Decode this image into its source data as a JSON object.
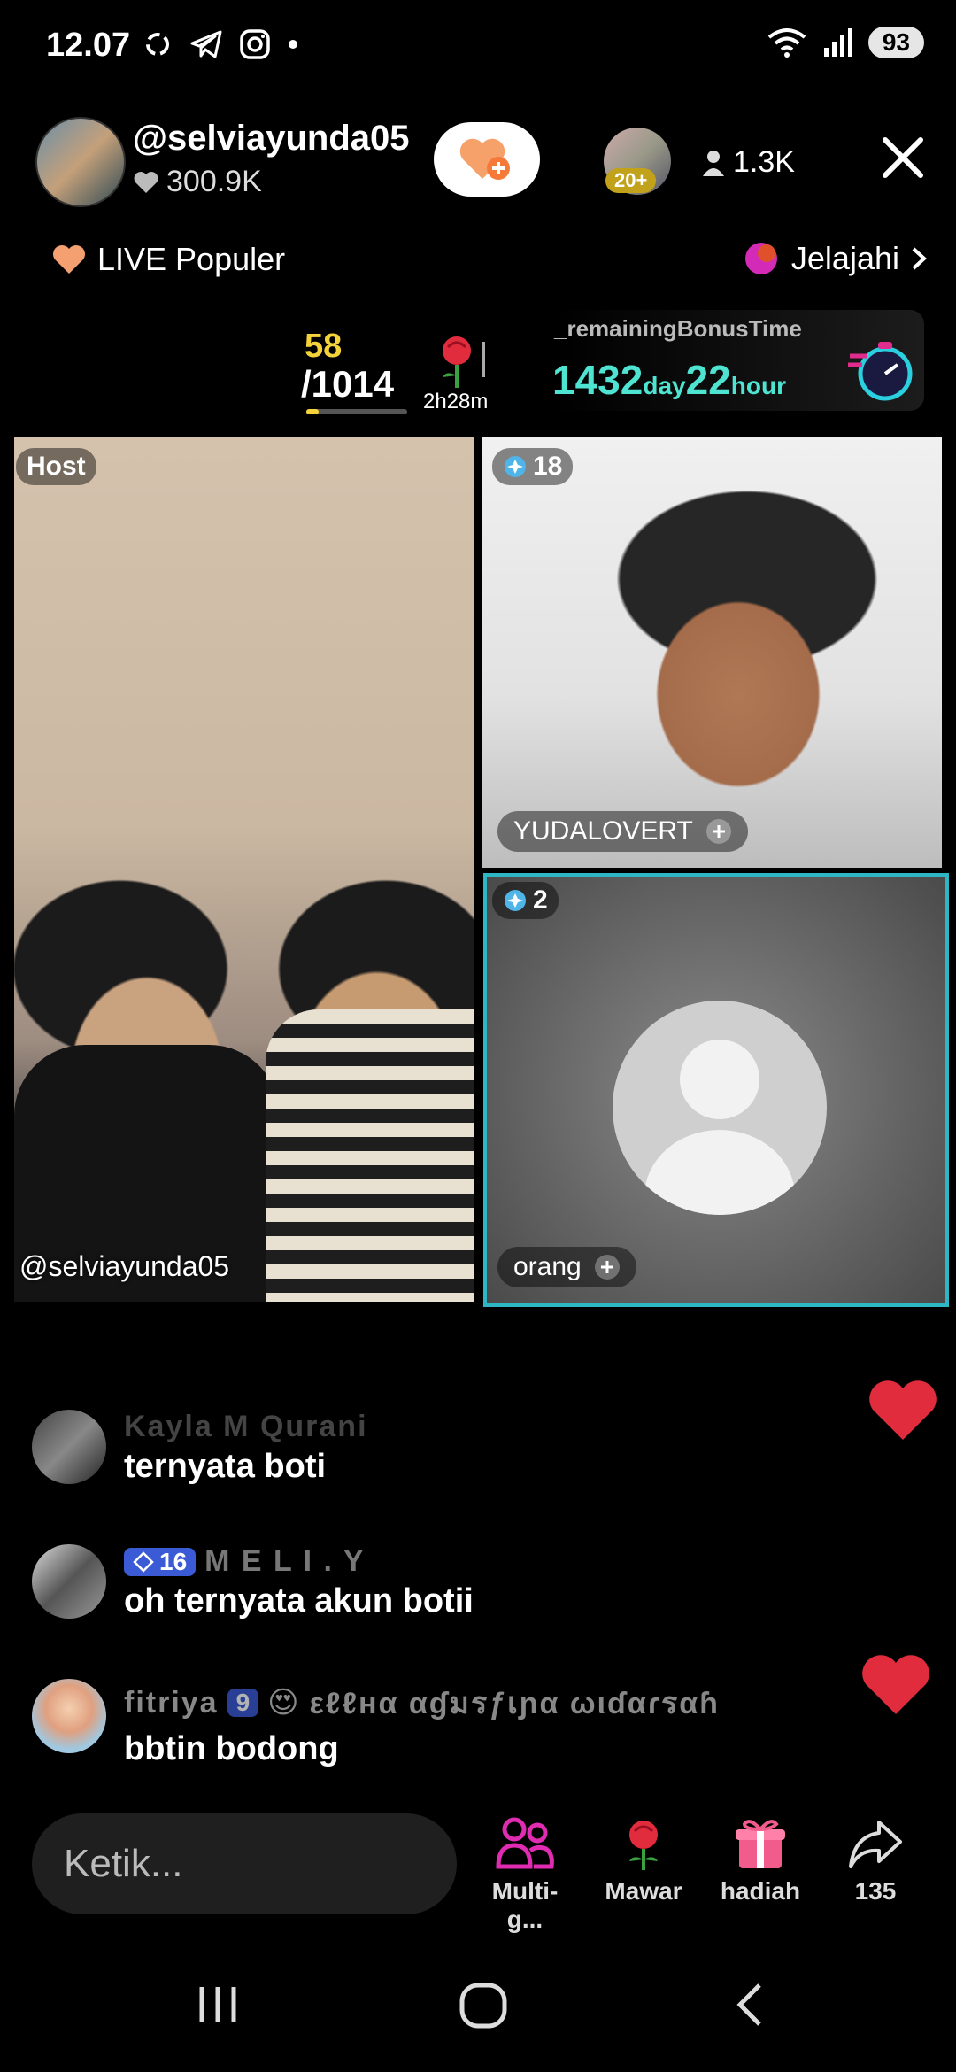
{
  "status": {
    "time": "12.07",
    "battery": "93",
    "icons": [
      "sync-icon",
      "telegram-icon",
      "instagram-icon",
      "dot-icon",
      "wifi-icon",
      "signal-icon"
    ]
  },
  "host": {
    "username": "@selviayunda05",
    "likes": "300.9K",
    "follow_icon": "heart-plus-icon"
  },
  "viewers": {
    "badge": "20+",
    "count": "1.3K"
  },
  "top_links": {
    "live_popular": "LIVE Populer",
    "explore": "Jelajahi"
  },
  "rank": {
    "position": "58",
    "total": "/1014",
    "progress": 0.12,
    "time": "2h28m"
  },
  "bonus": {
    "label": "_remainingBonusTime",
    "days": "1432",
    "day_unit": "day",
    "hours": "22",
    "hour_unit": "hour"
  },
  "video": {
    "host_tag": "Host",
    "host_handle": "@selviayunda05",
    "guest_score": "18",
    "guest_name": "YUDALOVERT",
    "empty_score": "2",
    "empty_name": "orang"
  },
  "comments": [
    {
      "user": "Kayla M Qurani",
      "text": "ternyata boti"
    },
    {
      "user": "M E L I . Y",
      "level": "16",
      "text": "oh ternyata akun botii"
    },
    {
      "user": "fitriya",
      "level": "9",
      "user2": "εℓℓнα αɠมรƒเɲα ωιɗαɾรαɦ",
      "text": "bbtin bodong"
    }
  ],
  "bottom_bar": {
    "placeholder": "Ketik...",
    "multi_guest": "Multi-g...",
    "rose": "Mawar",
    "gift": "hadiah",
    "share_count": "135"
  },
  "colors": {
    "accent_teal": "#2fb6c4",
    "bonus_teal": "#4fe3d2",
    "rank_yellow": "#f4d23a",
    "heart_red": "#e02c3c",
    "level_blue": "#3b5bd6"
  }
}
